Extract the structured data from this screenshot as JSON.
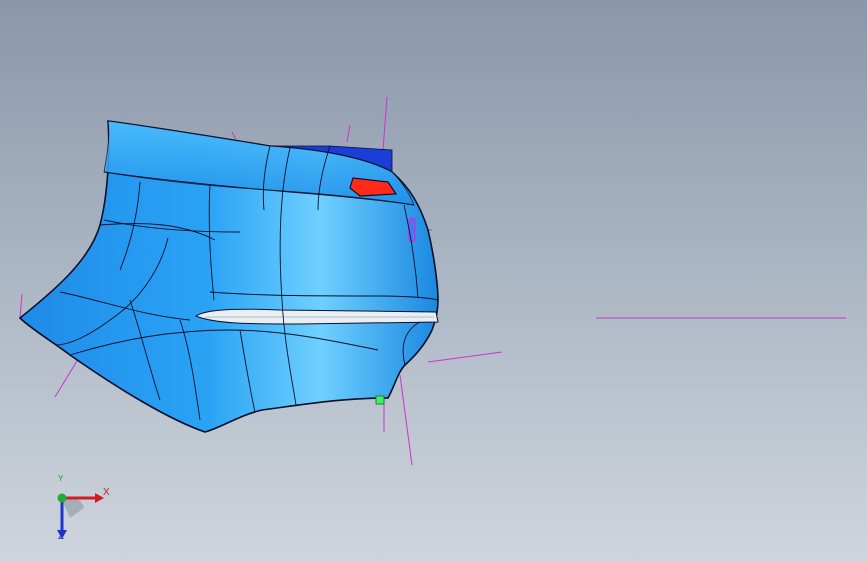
{
  "viewport": {
    "background_top": "#8a97aa",
    "background_bottom": "#cfd5dd"
  },
  "model": {
    "part": "rear-bumper",
    "body_color": "#2a9bf0",
    "edge_color": "#0a0f2a",
    "lamp_color": "#ff2a1a",
    "trim_color": "#e8eef2",
    "reference_line_color": "#cc33cc"
  },
  "triad": {
    "x_label": "X",
    "y_label": "Y",
    "z_label": "Z",
    "x_color": "#d0201e",
    "y_color": "#22aa33",
    "z_color": "#2233cc"
  }
}
